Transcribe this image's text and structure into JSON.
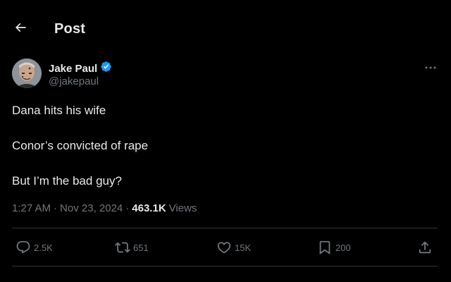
{
  "header": {
    "title": "Post"
  },
  "author": {
    "display_name": "Jake Paul",
    "handle": "@jakepaul",
    "verified_color": "#1d9bf0"
  },
  "post": {
    "lines": [
      "Dana hits his wife",
      "Conor’s convicted of rape",
      "But I’m the bad guy?"
    ],
    "time": "1:27 AM",
    "date": "Nov 23, 2024",
    "separator": "·",
    "views_count": "463.1K",
    "views_label": "Views"
  },
  "actions": {
    "replies": "2.5K",
    "reposts": "651",
    "likes": "15K",
    "bookmarks": "200"
  },
  "icons": {
    "back": "arrow-left-icon",
    "verified": "verified-badge-icon",
    "more": "more-horizontal-icon",
    "reply": "reply-icon",
    "repost": "repost-icon",
    "like": "heart-icon",
    "bookmark": "bookmark-icon",
    "share": "share-icon"
  },
  "colors": {
    "background": "#000000",
    "text": "#e7e9ea",
    "secondary": "#71767b",
    "divider": "#2f3336",
    "accent": "#1d9bf0"
  }
}
